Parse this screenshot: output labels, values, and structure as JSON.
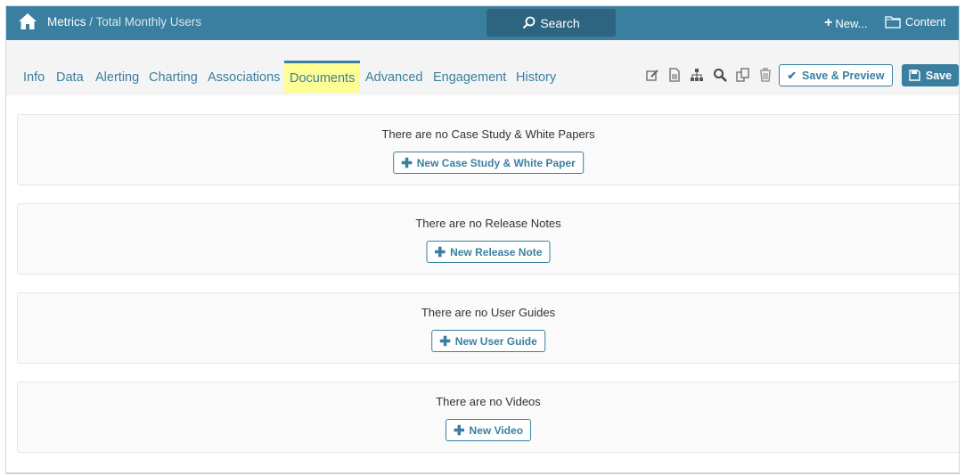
{
  "header": {
    "breadcrumb_root": "Metrics",
    "breadcrumb_sep": " / ",
    "breadcrumb_current": "Total Monthly Users",
    "search_label": "Search",
    "new_label": "New...",
    "content_label": "Content"
  },
  "tabs": [
    "Info",
    "Data",
    "Alerting",
    "Charting",
    "Associations",
    "Documents",
    "Advanced",
    "Engagement",
    "History"
  ],
  "active_tab": "Documents",
  "toolbar": {
    "save_preview_label": "Save & Preview",
    "save_label": "Save"
  },
  "sections": [
    {
      "message": "There are no Case Study & White Papers",
      "button": "New Case Study & White Paper"
    },
    {
      "message": "There are no Release Notes",
      "button": "New Release Note"
    },
    {
      "message": "There are no User Guides",
      "button": "New User Guide"
    },
    {
      "message": "There are no Videos",
      "button": "New Video"
    }
  ],
  "colors": {
    "brand": "#3a7fa0",
    "highlight": "#fdfd96"
  }
}
